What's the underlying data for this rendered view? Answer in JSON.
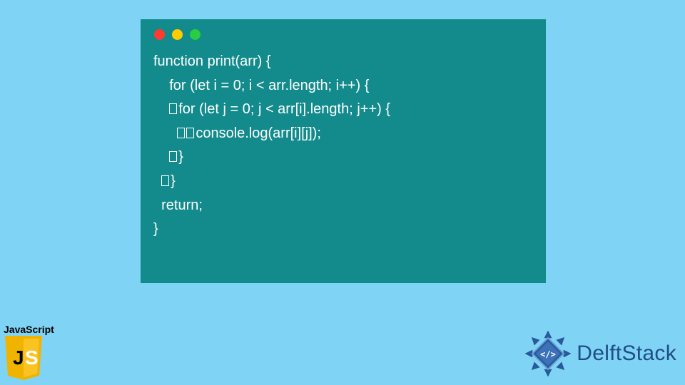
{
  "code": {
    "lines": [
      "function print(arr) {",
      "    for (let i = 0; i < arr.length; i++) {",
      "    □for (let j = 0; j < arr[i].length; j++) {",
      "      □□console.log(arr[i][j]);",
      "    □}",
      "  □}",
      "  return;",
      "}"
    ]
  },
  "branding": {
    "js_label": "JavaScript",
    "js_glyph": "JS",
    "delft_text": "DelftStack"
  },
  "colors": {
    "background": "#7fd4f5",
    "window": "#138b8c",
    "text": "#ffffff",
    "js_shield": "#f7b500",
    "delft_blue": "#1f4d86"
  }
}
